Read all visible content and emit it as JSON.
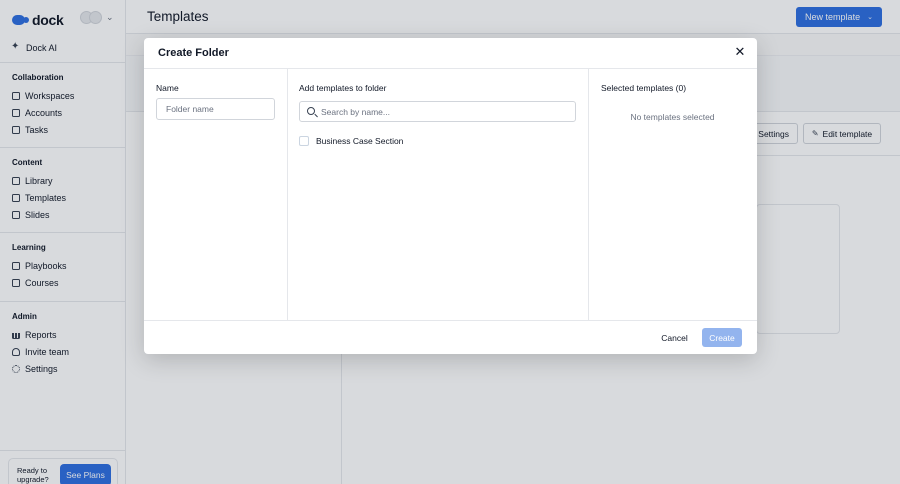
{
  "sidebar": {
    "logo_text": "dock",
    "top_item": {
      "label": "Dock AI",
      "icon": "sparkle-icon"
    },
    "sections": [
      {
        "heading": "Collaboration",
        "items": [
          {
            "label": "Workspaces",
            "icon": "workspaces-icon"
          },
          {
            "label": "Accounts",
            "icon": "accounts-icon"
          },
          {
            "label": "Tasks",
            "icon": "tasks-icon"
          }
        ]
      },
      {
        "heading": "Content",
        "items": [
          {
            "label": "Library",
            "icon": "library-icon"
          },
          {
            "label": "Templates",
            "icon": "templates-icon"
          },
          {
            "label": "Slides",
            "icon": "slides-icon"
          }
        ]
      },
      {
        "heading": "Learning",
        "items": [
          {
            "label": "Playbooks",
            "icon": "playbooks-icon"
          },
          {
            "label": "Courses",
            "icon": "courses-icon"
          }
        ]
      },
      {
        "heading": "Admin",
        "items": [
          {
            "label": "Reports",
            "icon": "reports-icon"
          },
          {
            "label": "Invite team",
            "icon": "invite-icon"
          },
          {
            "label": "Settings",
            "icon": "gear-icon"
          }
        ]
      }
    ],
    "upgrade": {
      "text": "Ready to upgrade?",
      "button": "See Plans"
    }
  },
  "header": {
    "title": "Templates",
    "new_template_label": "New template"
  },
  "background_actions": {
    "settings_label": "Settings",
    "edit_template_label": "Edit template"
  },
  "modal": {
    "title": "Create Folder",
    "name_label": "Name",
    "name_placeholder": "Folder name",
    "add_label": "Add templates to folder",
    "search_placeholder": "Search by name...",
    "templates": [
      {
        "name": "Business Case Section",
        "checked": false
      }
    ],
    "selected_label": "Selected templates (0)",
    "empty_message": "No templates selected",
    "cancel_label": "Cancel",
    "create_label": "Create"
  },
  "colors": {
    "accent": "#2f6fe0",
    "create_disabled": "#93b4ee"
  }
}
